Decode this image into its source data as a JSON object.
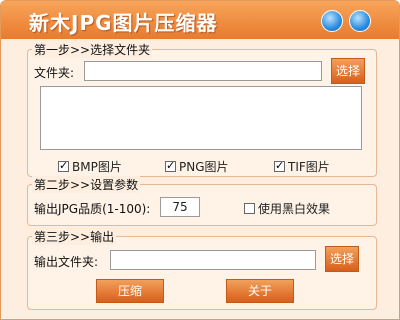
{
  "title": "新木JPG图片压缩器",
  "step1": {
    "heading": "第一步>>选择文件夹",
    "folder_label": "文件夹:",
    "folder_value": "",
    "select_label": "选择",
    "checks": [
      {
        "label": "BMP图片",
        "checked": true
      },
      {
        "label": "PNG图片",
        "checked": true
      },
      {
        "label": "TIF图片",
        "checked": true
      }
    ]
  },
  "step2": {
    "heading": "第二步>>设置参数",
    "quality_label": "输出JPG品质(1-100):",
    "quality_value": "75",
    "bw_label": "使用黑白效果",
    "bw_checked": false
  },
  "step3": {
    "heading": "第三步>>输出",
    "output_label": "输出文件夹:",
    "output_value": "",
    "select_label": "选择"
  },
  "buttons": {
    "compress": "压缩",
    "about": "关于"
  }
}
